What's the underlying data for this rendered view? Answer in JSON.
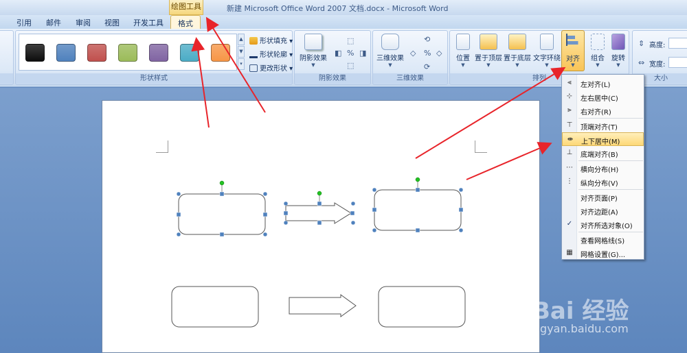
{
  "window": {
    "title": "新建 Microsoft Office Word 2007 文档.docx - Microsoft Word",
    "contextual_tab_group": "绘图工具"
  },
  "tabs": {
    "items": [
      "引用",
      "邮件",
      "审阅",
      "视图",
      "开发工具"
    ],
    "active": "格式"
  },
  "ribbon": {
    "shape_styles": {
      "label": "形状样式",
      "fill": "形状填充",
      "outline": "形状轮廓",
      "change_shape": "更改形状",
      "swatches": [
        "#0d0d0d",
        "#4f81bd",
        "#c0504d",
        "#9bbb59",
        "#8064a2",
        "#4bacc6",
        "#f79646"
      ]
    },
    "shadow": {
      "label": "阴影效果",
      "button": "阴影效果"
    },
    "three_d": {
      "label": "三维效果",
      "button": "三维效果"
    },
    "arrange": {
      "label": "排列",
      "position": "位置",
      "bring_front": "置于顶层",
      "send_back": "置于底层",
      "text_wrap": "文字环绕",
      "align": "对齐",
      "group": "组合",
      "rotate": "旋转"
    },
    "size": {
      "label": "大小",
      "height": "高度:",
      "width": "宽度:"
    }
  },
  "align_menu": {
    "items": [
      {
        "label": "左对齐(L)",
        "icon": "align-left-icon"
      },
      {
        "label": "左右居中(C)",
        "icon": "align-center-icon"
      },
      {
        "label": "右对齐(R)",
        "icon": "align-right-icon"
      },
      {
        "label": "顶端对齐(T)",
        "icon": "align-top-icon"
      },
      {
        "label": "上下居中(M)",
        "icon": "align-middle-icon",
        "highlighted": true
      },
      {
        "label": "底端对齐(B)",
        "icon": "align-bottom-icon"
      },
      {
        "label": "横向分布(H)",
        "icon": "distribute-horizontal-icon"
      },
      {
        "label": "纵向分布(V)",
        "icon": "distribute-vertical-icon"
      },
      {
        "label": "对齐页面(P)",
        "icon": ""
      },
      {
        "label": "对齐边距(A)",
        "icon": ""
      },
      {
        "label": "对齐所选对象(O)",
        "icon": "checkmark-icon",
        "checked": true
      },
      {
        "label": "查看网格线(S)",
        "icon": ""
      },
      {
        "label": "网格设置(G)...",
        "icon": "grid-icon"
      }
    ]
  },
  "watermark": {
    "logo": "Bai 经验",
    "url": "jingyan.baidu.com"
  },
  "colors": {
    "accent_highlight": "#fdd877",
    "annotation_arrow": "#e8242a",
    "handle": "#4f81bd",
    "rotate_handle": "#22c222"
  }
}
